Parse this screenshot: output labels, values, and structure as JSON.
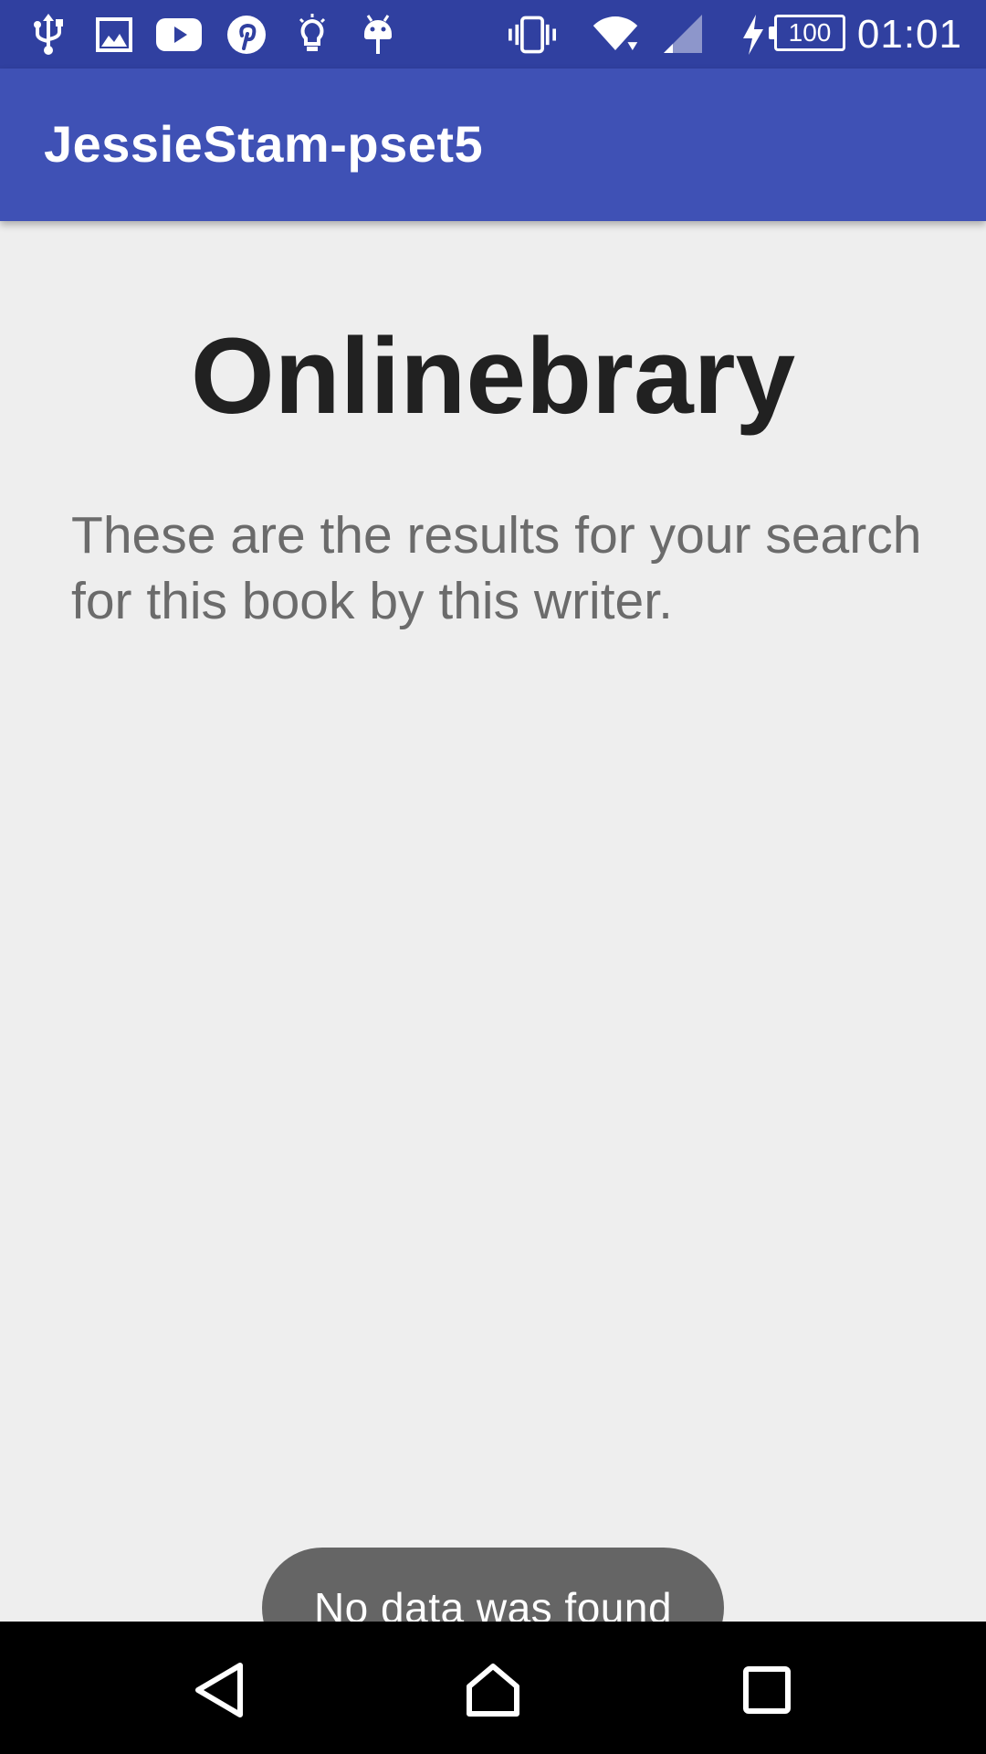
{
  "status_bar": {
    "left_icons": [
      "usb-icon",
      "image-icon",
      "youtube-icon",
      "pinterest-icon",
      "lightbulb-icon",
      "android-icon"
    ],
    "right_icons": [
      "vibrate-icon",
      "wifi-icon",
      "signal-icon",
      "charging-icon"
    ],
    "battery_level": "100",
    "time": "01:01"
  },
  "app_bar": {
    "title": "JessieStam-pset5"
  },
  "main": {
    "heading": "Onlinebrary",
    "description": "These are the results for your search for this book by this writer."
  },
  "toast": {
    "message": "No data was found"
  },
  "nav_bar": {
    "buttons": [
      "back-icon",
      "home-icon",
      "recents-icon"
    ]
  },
  "colors": {
    "status_bar": "#3040a0",
    "app_bar": "#3f51b5",
    "background": "#eeeeee",
    "toast": "#656565"
  }
}
